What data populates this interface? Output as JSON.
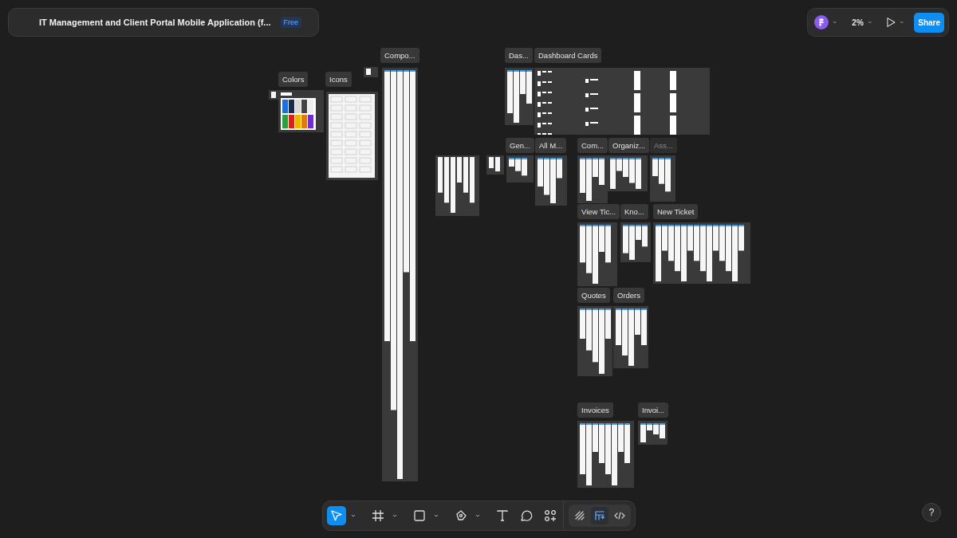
{
  "file": {
    "title": "IT Management and Client Portal Mobile Application (f...",
    "plan_badge": "Free"
  },
  "zoom": "2%",
  "share_label": "Share",
  "tools": [
    {
      "kind": "move",
      "selected": true,
      "has_menu": true
    },
    {
      "kind": "frame",
      "selected": false,
      "has_menu": true
    },
    {
      "kind": "rectangle",
      "selected": false,
      "has_menu": true
    },
    {
      "kind": "pen",
      "selected": false,
      "has_menu": true
    },
    {
      "kind": "text",
      "selected": false,
      "has_menu": false
    },
    {
      "kind": "comment",
      "selected": false,
      "has_menu": false
    },
    {
      "kind": "actions",
      "selected": false,
      "has_menu": false
    }
  ],
  "modes": [
    {
      "kind": "draw",
      "selected": false
    },
    {
      "kind": "design",
      "selected": true
    },
    {
      "kind": "dev",
      "selected": false
    }
  ],
  "sections": [
    {
      "label": "Colors",
      "kind": "swatches",
      "faded": false
    },
    {
      "label": "Icons",
      "kind": "icons",
      "faded": false
    },
    {
      "label": "Compo...",
      "kind": "screens",
      "faded": false
    },
    {
      "label": "Das...",
      "kind": "screens",
      "faded": false
    },
    {
      "label": "Dashboard Cards",
      "kind": "cards",
      "faded": false
    },
    {
      "label": "Gen...",
      "kind": "screens",
      "faded": false
    },
    {
      "label": "All M...",
      "kind": "screens",
      "faded": false
    },
    {
      "label": "Com...",
      "kind": "screens",
      "faded": false
    },
    {
      "label": "Organiz...",
      "kind": "screens",
      "faded": false
    },
    {
      "label": "Ass...",
      "kind": "screens",
      "faded": true
    },
    {
      "label": "View Tic...",
      "kind": "screens",
      "faded": false
    },
    {
      "label": "Kno...",
      "kind": "screens",
      "faded": false
    },
    {
      "label": "New Ticket",
      "kind": "screens",
      "faded": false
    },
    {
      "label": "Quotes",
      "kind": "screens",
      "faded": false
    },
    {
      "label": "Orders",
      "kind": "screens",
      "faded": false
    },
    {
      "label": "Invoices",
      "kind": "screens",
      "faded": false
    },
    {
      "label": "Invoi...",
      "kind": "screens",
      "faded": false
    }
  ],
  "help_label": "?"
}
